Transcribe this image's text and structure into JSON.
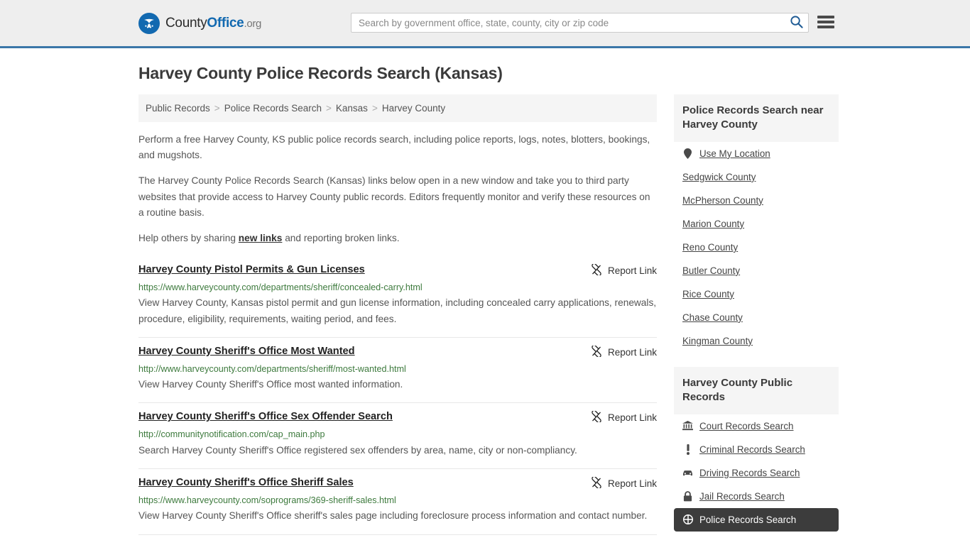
{
  "header": {
    "brand": {
      "part1": "County",
      "part2": "Office",
      "part3": ".org",
      "icon": "eagle-shield-logo"
    },
    "search": {
      "value": "",
      "placeholder": "Search by government office, state, county, city or zip code",
      "button_icon": "search-icon"
    },
    "menu_icon": "hamburger-menu-icon"
  },
  "page_title": "Harvey County Police Records Search (Kansas)",
  "breadcrumb": {
    "items": [
      {
        "label": "Public Records",
        "current": false
      },
      {
        "label": "Police Records Search",
        "current": false
      },
      {
        "label": "Kansas",
        "current": false
      },
      {
        "label": "Harvey County",
        "current": true
      }
    ],
    "separator": ">"
  },
  "intro": {
    "p1": "Perform a free Harvey County, KS public police records search, including police reports, logs, notes, blotters, bookings, and mugshots.",
    "p2": "The Harvey County Police Records Search (Kansas) links below open in a new window and take you to third party websites that provide access to Harvey County public records. Editors frequently monitor and verify these resources on a routine basis.",
    "p3_before": "Help others by sharing ",
    "p3_link": "new links",
    "p3_after": " and reporting broken links."
  },
  "report_link_label": "Report Link",
  "report_link_icon": "broken-link-icon",
  "results": [
    {
      "title": "Harvey County Pistol Permits & Gun Licenses",
      "url": "https://www.harveycounty.com/departments/sheriff/concealed-carry.html",
      "description": "View Harvey County, Kansas pistol permit and gun license information, including concealed carry applications, renewals, procedure, eligibility, requirements, waiting period, and fees."
    },
    {
      "title": "Harvey County Sheriff's Office Most Wanted",
      "url": "http://www.harveycounty.com/departments/sheriff/most-wanted.html",
      "description": "View Harvey County Sheriff's Office most wanted information."
    },
    {
      "title": "Harvey County Sheriff's Office Sex Offender Search",
      "url": "http://communitynotification.com/cap_main.php",
      "description": "Search Harvey County Sheriff's Office registered sex offenders by area, name, city or non-compliancy."
    },
    {
      "title": "Harvey County Sheriff's Office Sheriff Sales",
      "url": "https://www.harveycounty.com/soprograms/369-sheriff-sales.html",
      "description": "View Harvey County Sheriff's Office sheriff's sales page including foreclosure process information and contact number."
    }
  ],
  "sidebar": {
    "nearby": {
      "heading": "Police Records Search near Harvey County",
      "items": [
        {
          "label": "Use My Location",
          "icon": "map-pin-icon",
          "active": false
        },
        {
          "label": "Sedgwick County",
          "icon": "",
          "active": false
        },
        {
          "label": "McPherson County",
          "icon": "",
          "active": false
        },
        {
          "label": "Marion County",
          "icon": "",
          "active": false
        },
        {
          "label": "Reno County",
          "icon": "",
          "active": false
        },
        {
          "label": "Butler County",
          "icon": "",
          "active": false
        },
        {
          "label": "Rice County",
          "icon": "",
          "active": false
        },
        {
          "label": "Chase County",
          "icon": "",
          "active": false
        },
        {
          "label": "Kingman County",
          "icon": "",
          "active": false
        }
      ]
    },
    "public_records": {
      "heading": "Harvey County Public Records",
      "items": [
        {
          "label": "Court Records Search",
          "icon": "courthouse-icon",
          "active": false
        },
        {
          "label": "Criminal Records Search",
          "icon": "exclamation-icon",
          "active": false
        },
        {
          "label": "Driving Records Search",
          "icon": "car-icon",
          "active": false
        },
        {
          "label": "Jail Records Search",
          "icon": "lock-icon",
          "active": false
        },
        {
          "label": "Police Records Search",
          "icon": "police-badge-icon",
          "active": true
        }
      ]
    }
  },
  "colors": {
    "brand_blue": "#1269b0",
    "header_border": "#3a76a8",
    "url_green": "#3d7a3d",
    "active_bg": "#3c3c3c",
    "panel_bg": "#f5f5f5"
  }
}
